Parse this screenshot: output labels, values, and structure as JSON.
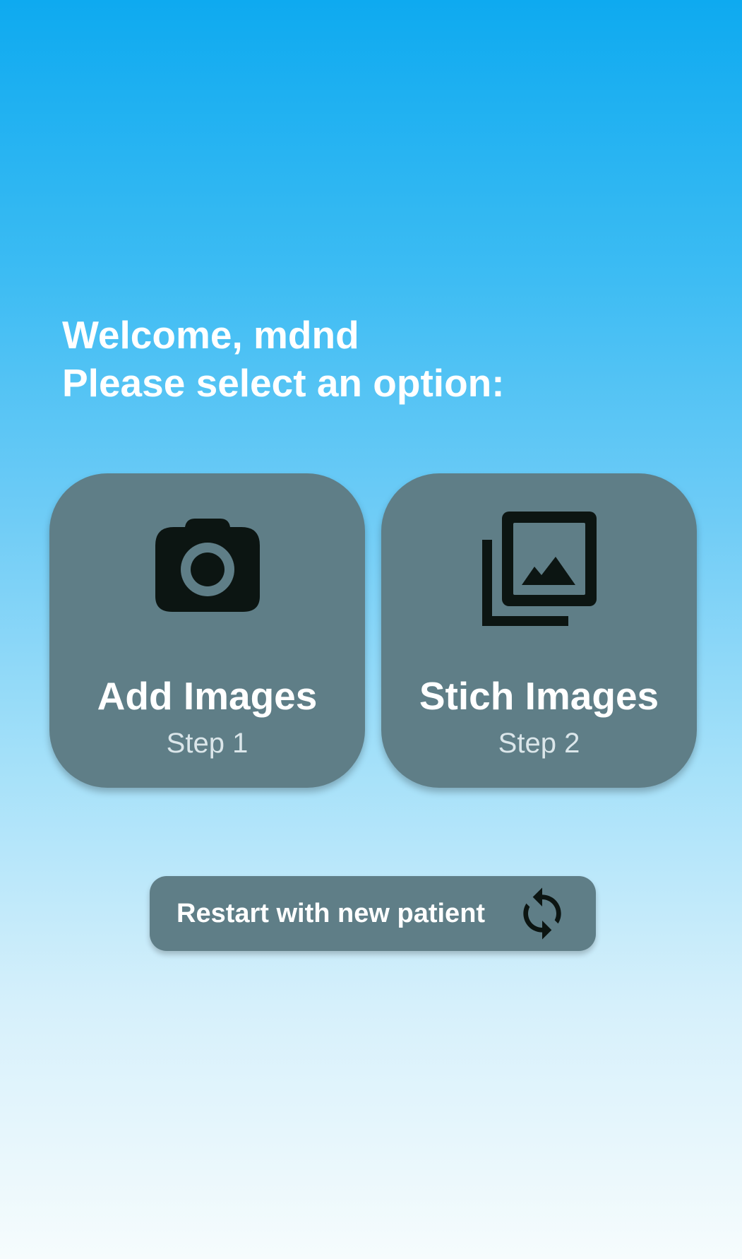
{
  "header": {
    "welcome": "Welcome, mdnd",
    "prompt": "Please select an option:"
  },
  "options": [
    {
      "title": "Add Images",
      "step": "Step 1",
      "icon": "camera-icon"
    },
    {
      "title": "Stich Images",
      "step": "Step 2",
      "icon": "photo-library-icon"
    }
  ],
  "restart": {
    "label": "Restart with new patient",
    "icon": "refresh-icon"
  },
  "colors": {
    "card": "#5f7e87",
    "icon": "#0c1512",
    "text": "#ffffff",
    "gradient_top": "#0eaaf0",
    "gradient_bottom": "#f6fcfd"
  }
}
